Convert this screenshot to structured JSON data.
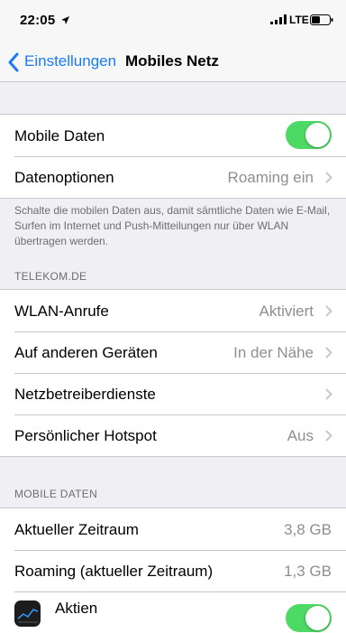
{
  "status": {
    "time": "22:05",
    "network": "LTE"
  },
  "nav": {
    "back_label": "Einstellungen",
    "title": "Mobiles Netz"
  },
  "group1": {
    "mobile_data_label": "Mobile Daten",
    "mobile_data_on": true,
    "data_options_label": "Datenoptionen",
    "data_options_value": "Roaming ein"
  },
  "footer_note": "Schalte die mobilen Daten aus, damit sämtliche Daten wie E-Mail, Surfen im Internet und Push-Mitteilungen nur über WLAN übertragen werden.",
  "section_telekom": "TELEKOM.DE",
  "telekom_items": [
    {
      "label": "WLAN-Anrufe",
      "value": "Aktiviert"
    },
    {
      "label": "Auf anderen Geräten",
      "value": "In der Nähe"
    },
    {
      "label": "Netzbetreiberdienste",
      "value": ""
    },
    {
      "label": "Persönlicher Hotspot",
      "value": "Aus"
    }
  ],
  "section_mobile": "MOBILE DATEN",
  "mobile_items": [
    {
      "label": "Aktueller Zeitraum",
      "value": "3,8 GB"
    },
    {
      "label": "Roaming (aktueller Zeitraum)",
      "value": "1,3 GB"
    },
    {
      "label": "Aktien",
      "icon": "stocks-icon",
      "toggle_on": true
    }
  ],
  "colors": {
    "accent": "#1a7cf5",
    "toggle_on": "#4cd964",
    "secondary_text": "#8e8e93"
  }
}
